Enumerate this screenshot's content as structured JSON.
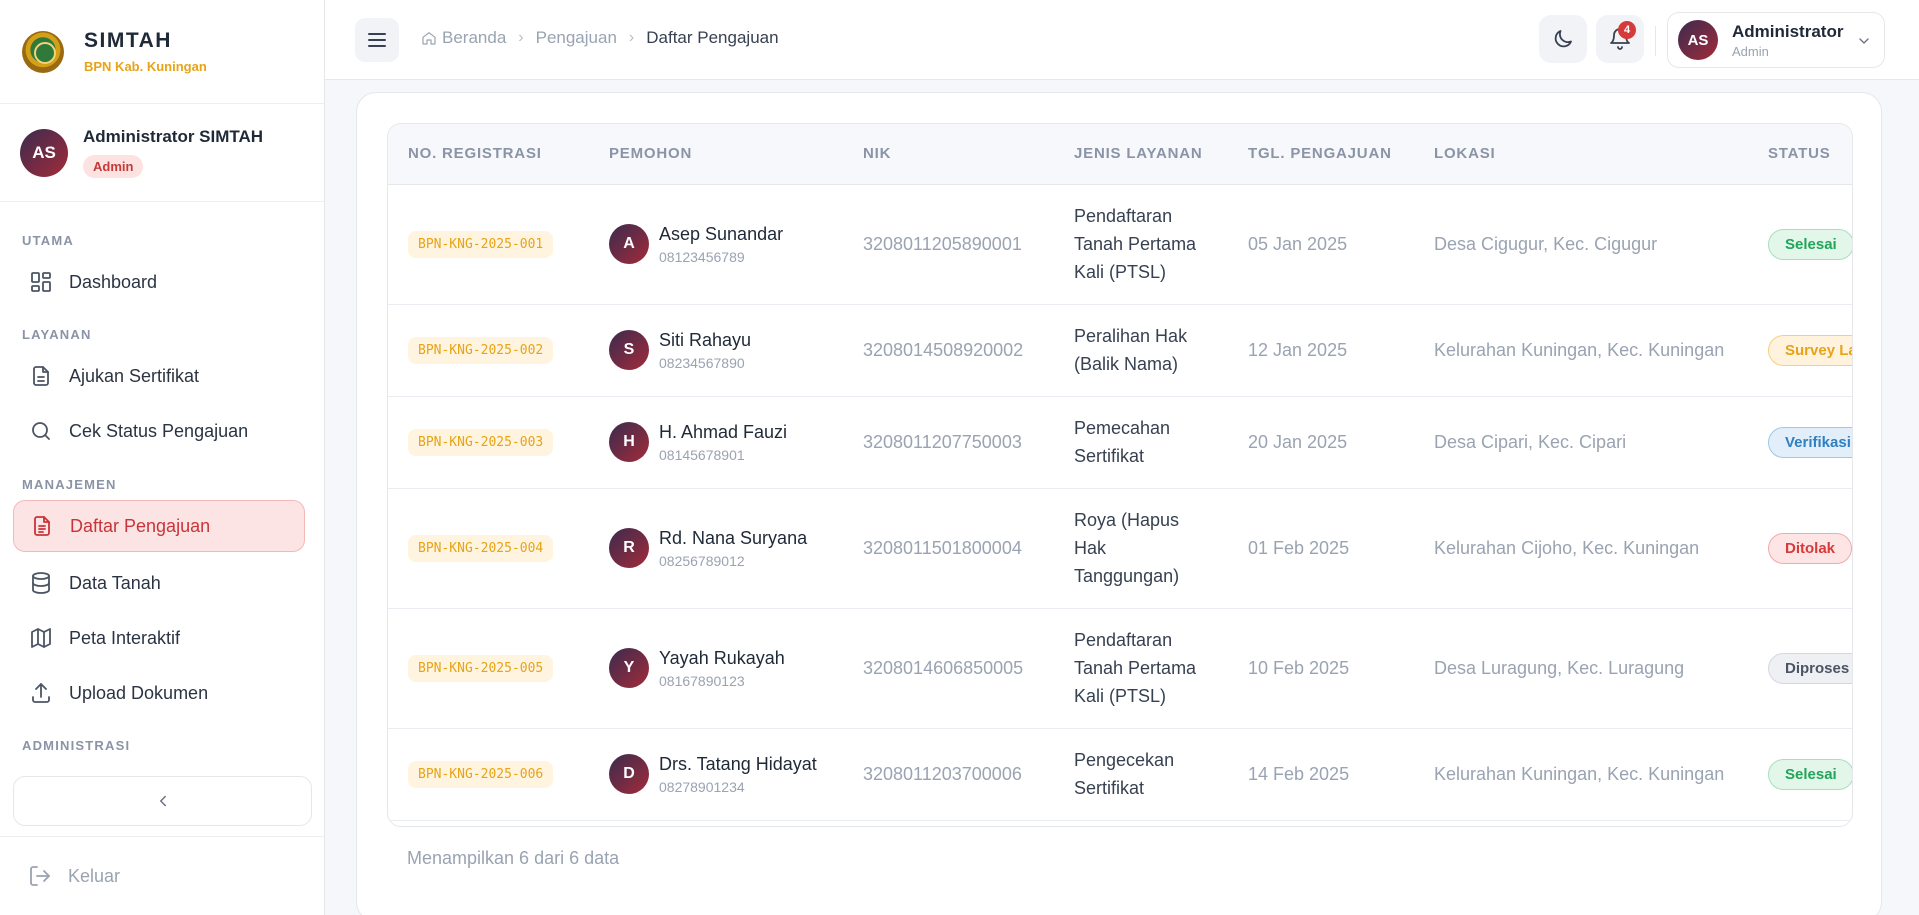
{
  "brand": {
    "name": "SIMTAH",
    "subtitle": "BPN Kab. Kuningan"
  },
  "profile": {
    "initials": "AS",
    "name": "Administrator SIMTAH",
    "role": "Admin"
  },
  "nav": {
    "section_utama": "UTAMA",
    "dashboard": "Dashboard",
    "section_layanan": "LAYANAN",
    "ajukan": "Ajukan Sertifikat",
    "cek_status": "Cek Status Pengajuan",
    "section_manajemen": "MANAJEMEN",
    "daftar": "Daftar Pengajuan",
    "data_tanah": "Data Tanah",
    "peta": "Peta Interaktif",
    "upload": "Upload Dokumen",
    "section_administrasi": "ADMINISTRASI",
    "logout": "Keluar"
  },
  "header": {
    "breadcrumb": [
      "Beranda",
      "Pengajuan",
      "Daftar Pengajuan"
    ],
    "notification_count": "4",
    "user": {
      "initials": "AS",
      "name": "Administrator",
      "role": "Admin"
    }
  },
  "table": {
    "columns": [
      "NO. REGISTRASI",
      "PEMOHON",
      "NIK",
      "JENIS LAYANAN",
      "TGL. PENGAJUAN",
      "LOKASI",
      "STATUS"
    ],
    "rows": [
      {
        "reg": "BPN-KNG-2025-001",
        "initial": "A",
        "name": "Asep Sunandar",
        "phone": "08123456789",
        "nik": "3208011205890001",
        "service": "Pendaftaran Tanah Pertama Kali (PTSL)",
        "date": "05 Jan 2025",
        "location": "Desa Cigugur, Kec. Cigugur",
        "status": "Selesai",
        "status_color": "#22a55a",
        "status_bg": "#e3f6ea",
        "status_border": "#a8dfbd"
      },
      {
        "reg": "BPN-KNG-2025-002",
        "initial": "S",
        "name": "Siti Rahayu",
        "phone": "08234567890",
        "nik": "3208014508920002",
        "service": "Peralihan Hak (Balik Nama)",
        "date": "12 Jan 2025",
        "location": "Kelurahan Kuningan, Kec. Kuningan",
        "status": "Survey Lapangan",
        "status_color": "#e8a316",
        "status_bg": "#fff3de",
        "status_border": "#f5cf85"
      },
      {
        "reg": "BPN-KNG-2025-003",
        "initial": "H",
        "name": "H. Ahmad Fauzi",
        "phone": "08145678901",
        "nik": "3208011207750003",
        "service": "Pemecahan Sertifikat",
        "date": "20 Jan 2025",
        "location": "Desa Cipari, Kec. Cipari",
        "status": "Verifikasi",
        "status_color": "#2f7fc1",
        "status_bg": "#e2effa",
        "status_border": "#9fc7e8"
      },
      {
        "reg": "BPN-KNG-2025-004",
        "initial": "R",
        "name": "Rd. Nana Suryana",
        "phone": "08256789012",
        "nik": "3208011501800004",
        "service": "Roya (Hapus Hak Tanggungan)",
        "date": "01 Feb 2025",
        "location": "Kelurahan Cijoho, Kec. Kuningan",
        "status": "Ditolak",
        "status_color": "#d63b3b",
        "status_bg": "#fde5e5",
        "status_border": "#f2aaaa"
      },
      {
        "reg": "BPN-KNG-2025-005",
        "initial": "Y",
        "name": "Yayah Rukayah",
        "phone": "08167890123",
        "nik": "3208014606850005",
        "service": "Pendaftaran Tanah Pertama Kali (PTSL)",
        "date": "10 Feb 2025",
        "location": "Desa Luragung, Kec. Luragung",
        "status": "Diproses",
        "status_color": "#4b5563",
        "status_bg": "#eef0f4",
        "status_border": "#d3d8e0"
      },
      {
        "reg": "BPN-KNG-2025-006",
        "initial": "D",
        "name": "Drs. Tatang Hidayat",
        "phone": "08278901234",
        "nik": "3208011203700006",
        "service": "Pengecekan Sertifikat",
        "date": "14 Feb 2025",
        "location": "Kelurahan Kuningan, Kec. Kuningan",
        "status": "Selesai",
        "status_color": "#22a55a",
        "status_bg": "#e3f6ea",
        "status_border": "#a8dfbd"
      }
    ]
  },
  "footer": {
    "summary": "Menampilkan 6 dari 6 data"
  }
}
